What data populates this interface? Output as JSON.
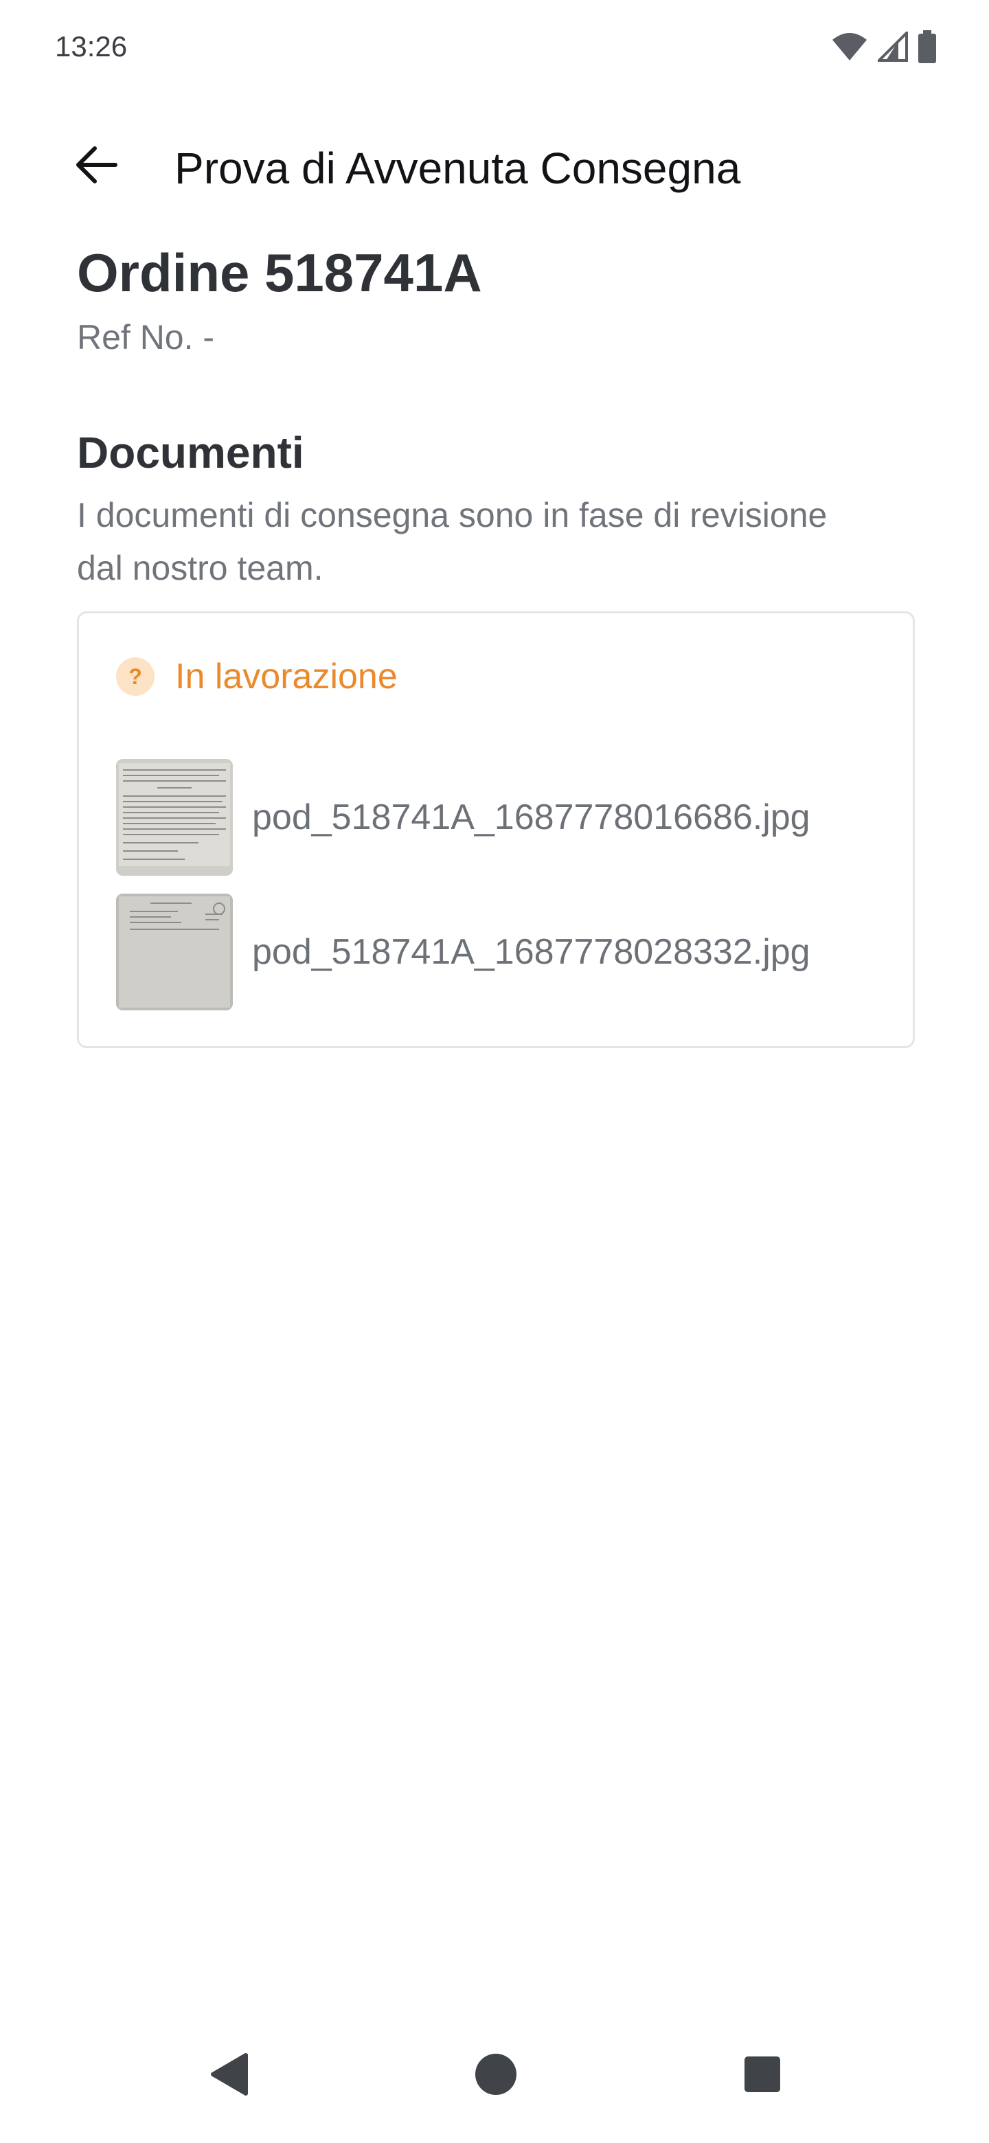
{
  "status_bar": {
    "time": "13:26",
    "icons": [
      "wifi-icon",
      "cellular-signal-icon",
      "battery-icon"
    ]
  },
  "app_bar": {
    "back_icon": "arrow-left-icon",
    "title": "Prova di Avvenuta Consegna"
  },
  "order": {
    "title": "Ordine 518741A",
    "ref_no": "Ref No. -"
  },
  "documents": {
    "title": "Documenti",
    "description": "I documenti di consegna sono in fase di revisione dal nostro team.",
    "status": {
      "icon": "question-mark-icon",
      "label": "In lavorazione",
      "color": "#EA8A2C"
    },
    "files": [
      {
        "name": "pod_518741A_1687778016686.jpg"
      },
      {
        "name": "pod_518741A_1687778028332.jpg"
      }
    ]
  },
  "nav_bar": {
    "icons": [
      "back-triangle-icon",
      "home-circle-icon",
      "recents-square-icon"
    ]
  }
}
